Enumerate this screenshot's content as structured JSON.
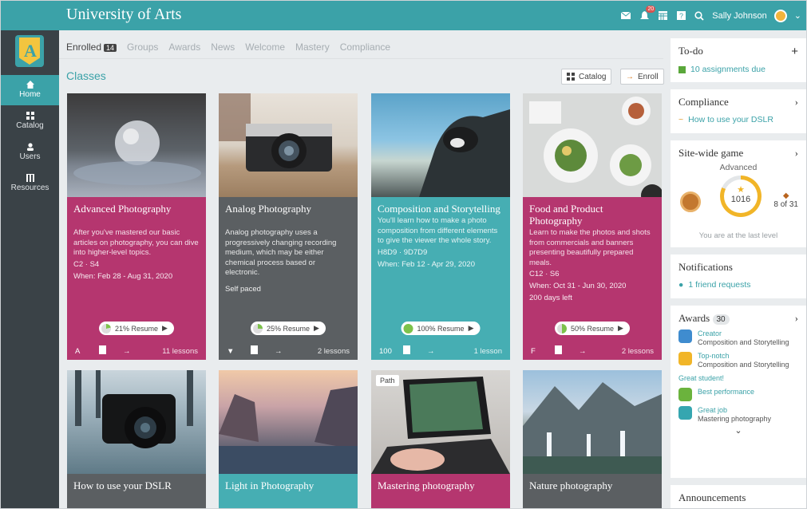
{
  "app": {
    "title": "University of Arts"
  },
  "topbar": {
    "notif_count": "20",
    "user_name": "Sally Johnson"
  },
  "sidebar": {
    "items": [
      {
        "label": "Home"
      },
      {
        "label": "Catalog"
      },
      {
        "label": "Users"
      },
      {
        "label": "Resources"
      }
    ]
  },
  "tabs": [
    {
      "label": "Enrolled",
      "count": "14"
    },
    {
      "label": "Groups"
    },
    {
      "label": "Awards"
    },
    {
      "label": "News"
    },
    {
      "label": "Welcome"
    },
    {
      "label": "Mastery"
    },
    {
      "label": "Compliance"
    }
  ],
  "main": {
    "title": "Classes",
    "catalog_btn": "Catalog",
    "enroll_btn": "Enroll"
  },
  "cards": [
    {
      "title": "Advanced Photography",
      "desc": "After you've mastered our basic articles on photography, you can dive into higher-level topics.",
      "code": "C2 · S4",
      "when": "When: Feb 28 - Aug 31, 2020",
      "extra": "",
      "resume": "21% Resume",
      "grade": "A",
      "lessons": "11 lessons",
      "color": "#b5366f"
    },
    {
      "title": "Analog Photography",
      "desc": "Analog photography uses a progressively changing recording medium, which may be either chemical process based or electronic.",
      "code": "Self paced",
      "when": "",
      "extra": "",
      "resume": "25% Resume",
      "grade": "",
      "lessons": "2 lessons",
      "color": "#5b5f62"
    },
    {
      "title": "Composition and Storytelling",
      "desc": "You'll learn how to make a photo composition from different elements to give the viewer the whole story.",
      "code": "H8D9 · 9D7D9",
      "when": "When: Feb 12 - Apr 29, 2020",
      "extra": "",
      "resume": "100% Resume",
      "grade": "100",
      "lessons": "1 lesson",
      "color": "#46aeb3"
    },
    {
      "title": "Food and Product Photography",
      "desc": "Learn to make the photos and shots from commercials and banners presenting beautifully prepared meals.",
      "code": "C12 · S6",
      "when": "When: Oct 31 - Jun 30, 2020",
      "extra": "200 days left",
      "resume": "50% Resume",
      "grade": "F",
      "lessons": "2 lessons",
      "color": "#b5366f"
    },
    {
      "title": "How to use your DSLR",
      "color": "#5b5f62"
    },
    {
      "title": "Light in Photography",
      "color": "#46aeb3"
    },
    {
      "title": "Mastering photography",
      "color": "#b5366f",
      "tag": "Path"
    },
    {
      "title": "Nature photography",
      "color": "#5b5f62"
    }
  ],
  "todo": {
    "title": "To-do",
    "plus": "+",
    "item": "10 assignments due"
  },
  "compliance": {
    "title": "Compliance",
    "item": "How to use your DSLR"
  },
  "game": {
    "title": "Site-wide game",
    "level": "Advanced",
    "points": "1016",
    "rank": "8 of 31",
    "note": "You are at the last level"
  },
  "notifications": {
    "title": "Notifications",
    "item": "1 friend requests"
  },
  "awards": {
    "title": "Awards",
    "count": "30",
    "items": [
      {
        "title": "Creator",
        "sub": "Composition and Storytelling"
      },
      {
        "title": "Top-notch",
        "sub": "Composition and Storytelling"
      },
      {
        "title": "Great student!",
        "sub": ""
      },
      {
        "title": "Best performance",
        "sub": ""
      },
      {
        "title": "Great job",
        "sub": "Mastering photography"
      }
    ]
  },
  "announcements": {
    "title": "Announcements"
  }
}
